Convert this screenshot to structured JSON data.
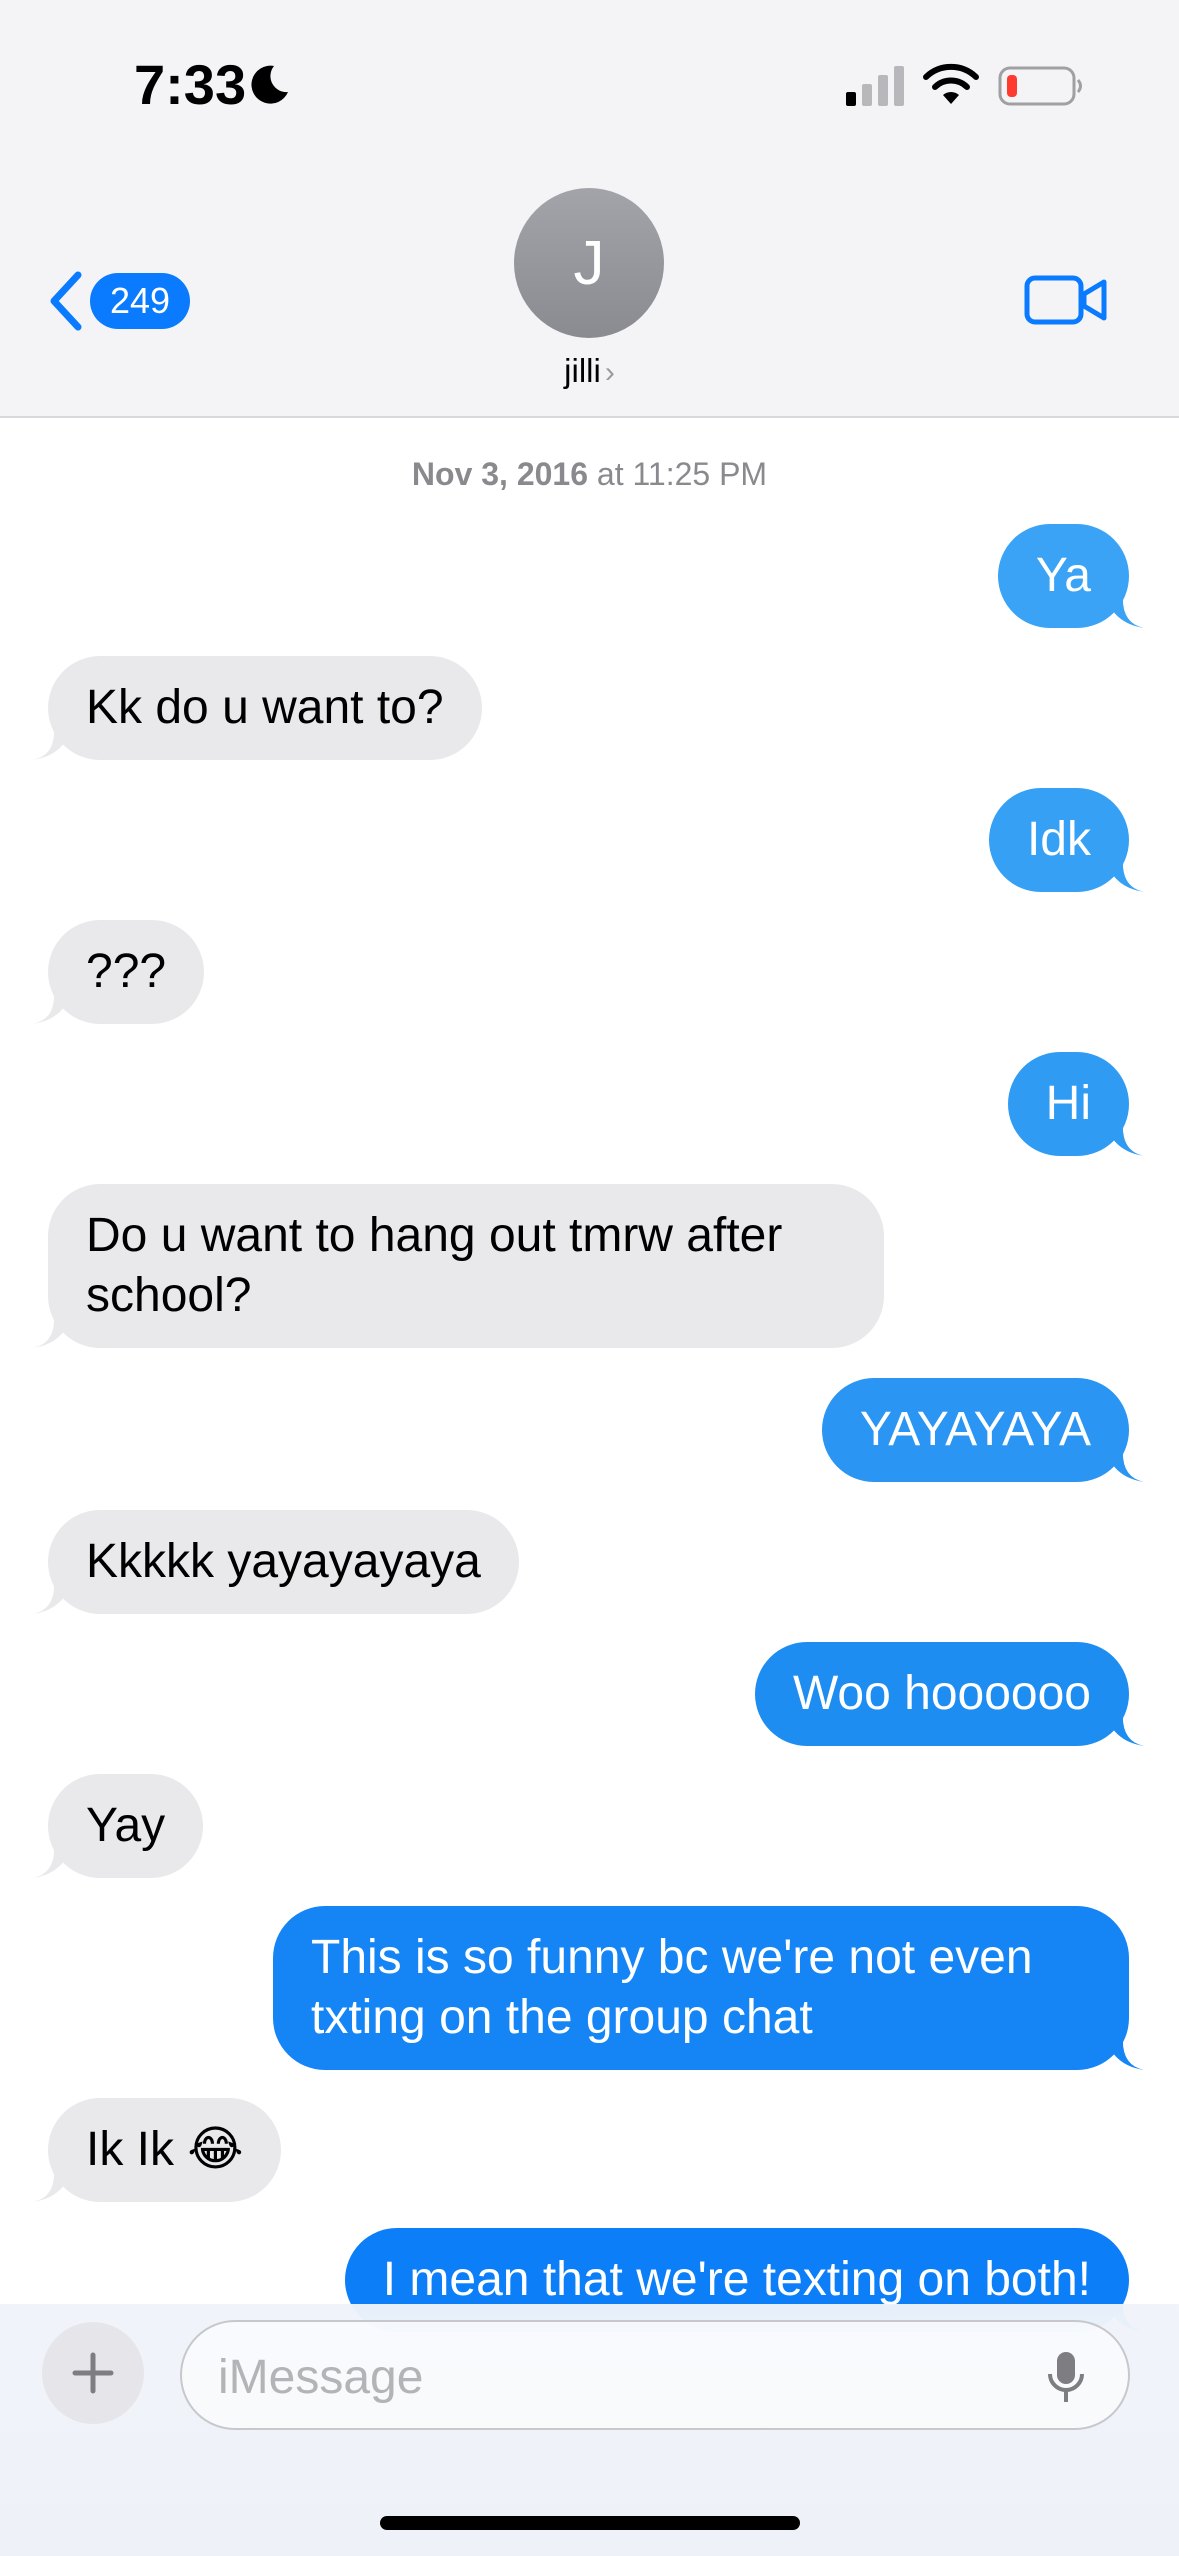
{
  "status_bar": {
    "time": "7:33",
    "icons": [
      "moon-icon",
      "cellular-signal-icon",
      "wifi-icon",
      "battery-low-icon"
    ]
  },
  "nav": {
    "back_count": "249",
    "avatar_initial": "J",
    "contact_name": "jilli",
    "contact_chevron": "›",
    "video_icon": "video-camera-icon"
  },
  "conversation": {
    "timestamp_date": "Nov 3, 2016",
    "timestamp_rest": " at 11:25 PM",
    "messages": [
      {
        "from": "me",
        "text": "Ya"
      },
      {
        "from": "them",
        "text": "Kk do u want to?"
      },
      {
        "from": "me",
        "text": "Idk"
      },
      {
        "from": "them",
        "text": "???"
      },
      {
        "from": "me",
        "text": "Hi"
      },
      {
        "from": "them",
        "text": "Do u want to hang out tmrw after school?"
      },
      {
        "from": "me",
        "text": "YAYAYAYA"
      },
      {
        "from": "them",
        "text": "Kkkkk yayayayaya"
      },
      {
        "from": "me",
        "text": "Woo hoooooo"
      },
      {
        "from": "them",
        "text": "Yay"
      },
      {
        "from": "me",
        "text": "This is so funny bc we're not even txting on the group chat"
      },
      {
        "from": "them",
        "text": "Ik Ik 😂"
      },
      {
        "from": "me",
        "text": "I mean that we're texting on both!"
      }
    ]
  },
  "composer": {
    "placeholder": "iMessage",
    "plus_icon": "plus-icon",
    "mic_icon": "microphone-icon"
  },
  "colors": {
    "imessage_blue": "#0a7bff",
    "light_blue": "#3aa3f5",
    "incoming_gray": "#e9e9eb"
  }
}
